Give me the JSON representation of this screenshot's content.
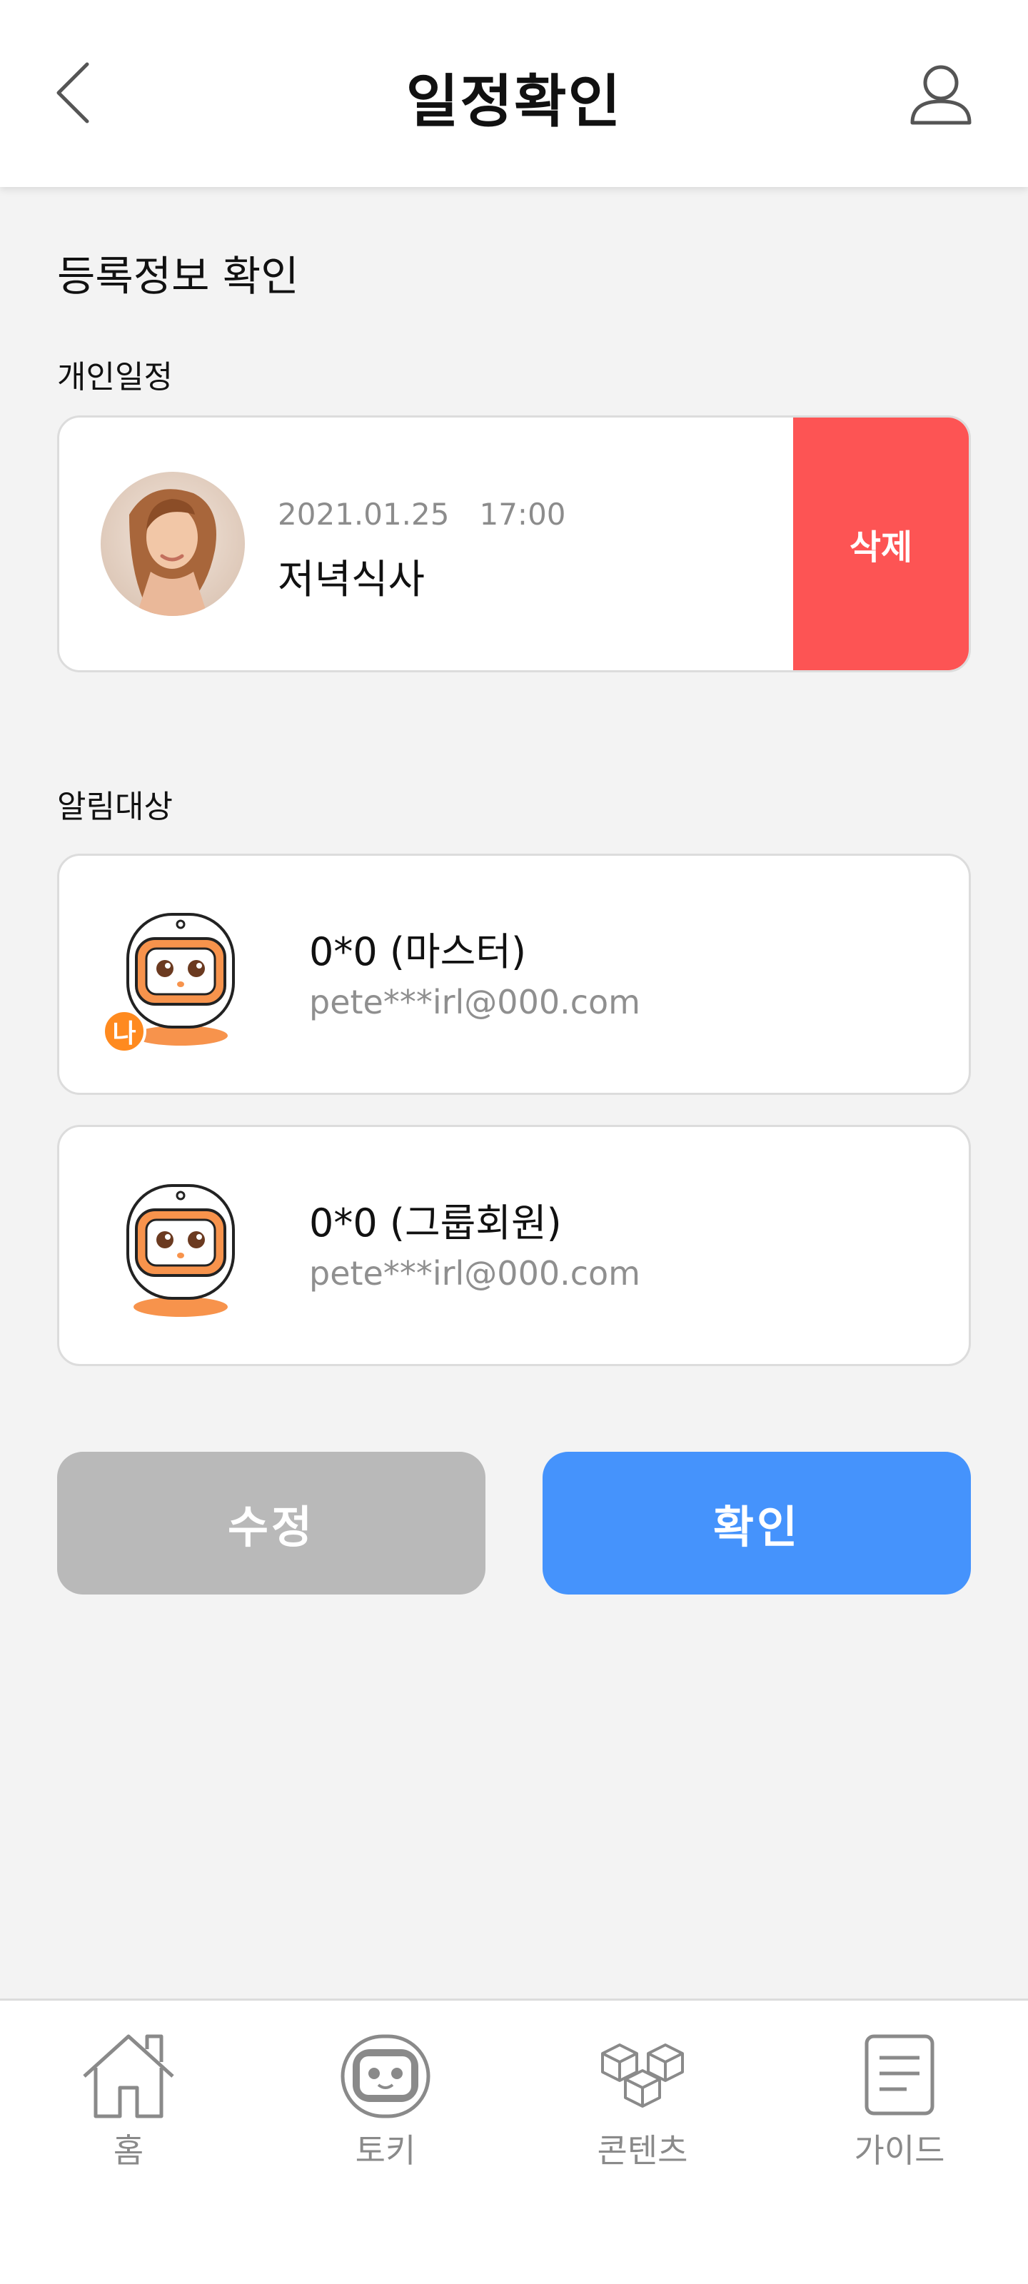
{
  "header": {
    "title": "일정확인"
  },
  "main": {
    "section_title": "등록정보 확인",
    "personal_label": "개인일정",
    "schedule": {
      "date": "2021.01.25　17:00",
      "title": "저녁식사",
      "delete_label": "삭제"
    },
    "notify_label": "알림대상",
    "members": [
      {
        "name": "0*0 (마스터)",
        "email": "pete***irl@000.com",
        "badge": "나"
      },
      {
        "name": "0*0 (그룹회원)",
        "email": "pete***irl@000.com"
      }
    ],
    "edit_label": "수정",
    "confirm_label": "확인"
  },
  "nav": {
    "items": [
      {
        "label": "홈",
        "icon": "home-icon"
      },
      {
        "label": "토키",
        "icon": "robot-icon"
      },
      {
        "label": "콘텐츠",
        "icon": "cubes-icon"
      },
      {
        "label": "가이드",
        "icon": "document-icon"
      }
    ]
  },
  "colors": {
    "delete": "#fd5454",
    "confirm": "#4593fc",
    "edit": "#b9b9b9",
    "robot_orange": "#f7934c",
    "badge": "#ff8a1f"
  }
}
